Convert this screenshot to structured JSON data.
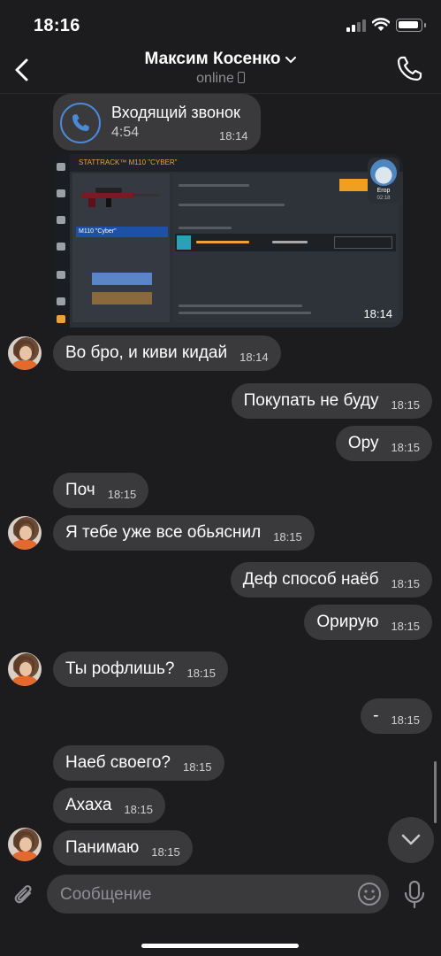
{
  "status_bar": {
    "time": "18:16"
  },
  "header": {
    "contact_name": "Максим Косенко",
    "status": "online"
  },
  "call": {
    "title": "Входящий звонок",
    "duration": "4:54",
    "time": "18:14"
  },
  "screenshot": {
    "time": "18:14",
    "topbar_text": "STATTRACK™ M110 \"CYBER\"",
    "weapon_label": "M110 \"Cyber\"",
    "caller": "Егор",
    "caller_time": "02:18"
  },
  "messages": [
    {
      "side": "in",
      "text": "Во бро, и киви кидай",
      "time": "18:14"
    },
    {
      "side": "out",
      "text": "Покупать не буду",
      "time": "18:15"
    },
    {
      "side": "out",
      "text": "Ору",
      "time": "18:15"
    },
    {
      "side": "in",
      "text": "Поч",
      "time": "18:15"
    },
    {
      "side": "in",
      "text": "Я тебе уже все обьяснил",
      "time": "18:15"
    },
    {
      "side": "out",
      "text": "Деф способ наёб",
      "time": "18:15"
    },
    {
      "side": "out",
      "text": "Орирую",
      "time": "18:15"
    },
    {
      "side": "in",
      "text": "Ты рофлишь?",
      "time": "18:15"
    },
    {
      "side": "out",
      "text": "-",
      "time": "18:15"
    },
    {
      "side": "in",
      "text": "Наеб своего?",
      "time": "18:15"
    },
    {
      "side": "in",
      "text": "Ахаха",
      "time": "18:15"
    },
    {
      "side": "in",
      "text": "Панимаю",
      "time": "18:15"
    }
  ],
  "composer": {
    "placeholder": "Сообщение"
  },
  "icons": {
    "back": "chevron-left-icon",
    "call": "phone-icon",
    "attach": "paperclip-icon",
    "emoji": "smiley-icon",
    "mic": "microphone-icon",
    "scroll_down": "chevron-down-icon"
  },
  "colors": {
    "bubble": "#3a3a3c",
    "background": "#1c1c1e",
    "accent": "#4a8ad9"
  }
}
